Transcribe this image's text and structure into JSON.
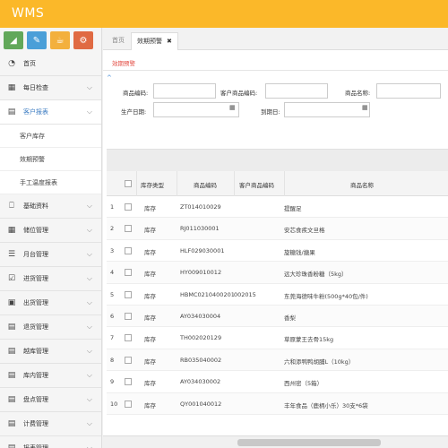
{
  "app": {
    "title": "WMS"
  },
  "quick_buttons": [
    "chart-icon",
    "pencil-icon",
    "cup-icon",
    "gears-icon"
  ],
  "sidebar": {
    "items": [
      {
        "label": "首页",
        "icon": "dashboard-icon"
      },
      {
        "label": "每日检查",
        "icon": "calendar-icon"
      },
      {
        "label": "客户报表",
        "icon": "table-icon"
      },
      {
        "label": "基础资料",
        "icon": "file-icon"
      },
      {
        "label": "储位管理",
        "icon": "grid-icon"
      },
      {
        "label": "月台管理",
        "icon": "list-icon"
      },
      {
        "label": "进货管理",
        "icon": "checkbox-icon"
      },
      {
        "label": "出货管理",
        "icon": "truck-icon"
      },
      {
        "label": "退货管理",
        "icon": "table-icon"
      },
      {
        "label": "越库管理",
        "icon": "table-icon"
      },
      {
        "label": "库内管理",
        "icon": "table-icon"
      },
      {
        "label": "盘点管理",
        "icon": "table-icon"
      },
      {
        "label": "计费管理",
        "icon": "table-icon"
      },
      {
        "label": "报表管理",
        "icon": "table-icon"
      }
    ],
    "sub_items": [
      "客户库存",
      "效期预警",
      "手工温度报表"
    ]
  },
  "tabs": {
    "home": "首页",
    "active": "效期预警"
  },
  "breadcrumb": "效期预警",
  "filters": {
    "product_code": "商品编码:",
    "customer_product_code": "客户商品编码:",
    "product_name": "商品名称:",
    "production_date": "生产日期:",
    "expiry_date": "到期日:"
  },
  "table": {
    "headers": [
      "库存类型",
      "商品编码",
      "客户商品编码",
      "商品名称"
    ],
    "rows": [
      {
        "no": "1",
        "type": "库存",
        "code": "ZT014010029",
        "cust": "",
        "name": "提醒足"
      },
      {
        "no": "2",
        "type": "库存",
        "code": "RJ011030001",
        "cust": "",
        "name": "安芯食疾文旦格"
      },
      {
        "no": "3",
        "type": "库存",
        "code": "HLF029030001",
        "cust": "",
        "name": "旋糖钱/搪果"
      },
      {
        "no": "4",
        "type": "库存",
        "code": "HY009010012",
        "cust": "",
        "name": "远大珍珠香粉糖（5kg）"
      },
      {
        "no": "5",
        "type": "库存",
        "code": "HBMC0210400201",
        "cust": "002015",
        "name": "东莞海德味牛粉(500g*40包/件)"
      },
      {
        "no": "6",
        "type": "库存",
        "code": "AY034030004",
        "cust": "",
        "name": "香梨"
      },
      {
        "no": "7",
        "type": "库存",
        "code": "TH002020129",
        "cust": "",
        "name": "草原蒙王去骨15kg"
      },
      {
        "no": "8",
        "type": "库存",
        "code": "RB035040002",
        "cust": "",
        "name": "六和添鸭鸭胡脯L（10kg）"
      },
      {
        "no": "9",
        "type": "库存",
        "code": "AY034030002",
        "cust": "",
        "name": "西州密（5箱）"
      },
      {
        "no": "10",
        "type": "库存",
        "code": "QY001040012",
        "cust": "",
        "name": "丰年食品（鹿柄小乐）30支*6袋"
      }
    ]
  },
  "colors": {
    "topbar": "#fbb829",
    "breadcrumb": "#e34b42",
    "link": "#4a90d9"
  }
}
